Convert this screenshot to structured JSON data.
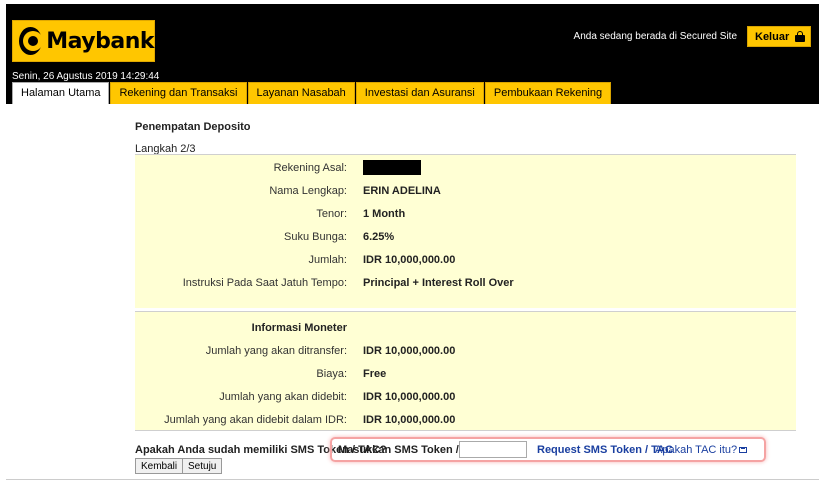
{
  "header": {
    "logo_text": "Maybank",
    "secured_text": "Anda sedang berada di Secured Site",
    "logout_label": "Keluar",
    "datetime": "Senin, 26 Agustus 2019 14:29:44"
  },
  "tabs": [
    {
      "label": "Halaman Utama",
      "active": true
    },
    {
      "label": "Rekening dan Transaksi",
      "active": false
    },
    {
      "label": "Layanan Nasabah",
      "active": false
    },
    {
      "label": "Investasi dan Asuransi",
      "active": false
    },
    {
      "label": "Pembukaan Rekening",
      "active": false
    }
  ],
  "main": {
    "title": "Penempatan Deposito",
    "step": "Langkah 2/3",
    "details": [
      {
        "label": "Rekening Asal:",
        "value": ""
      },
      {
        "label": "Nama Lengkap:",
        "value": "ERIN ADELINA"
      },
      {
        "label": "Tenor:",
        "value": "1 Month"
      },
      {
        "label": "Suku Bunga:",
        "value": "6.25%"
      },
      {
        "label": "Jumlah:",
        "value": "IDR 10,000,000.00"
      },
      {
        "label": "Instruksi Pada Saat Jatuh Tempo:",
        "value": "Principal + Interest Roll Over"
      }
    ],
    "money_info_heading": "Informasi Moneter",
    "money_info": [
      {
        "label": "Jumlah yang akan ditransfer:",
        "value": "IDR 10,000,000.00"
      },
      {
        "label": "Biaya:",
        "value": "Free"
      },
      {
        "label": "Jumlah yang akan didebit:",
        "value": "IDR 10,000,000.00"
      },
      {
        "label": "Jumlah yang akan didebit dalam IDR:",
        "value": "IDR 10,000,000.00"
      }
    ],
    "token_question": "Apakah Anda sudah memiliki SMS Token / TAC?",
    "token_input_label": "Masukkan SMS Token / TAC:",
    "token_input_value": "",
    "request_token_link": "Request SMS Token / TAC",
    "what_is_tac_link": "Apakah TAC itu?",
    "back_button": "Kembali",
    "agree_button": "Setuju"
  },
  "colors": {
    "brand_yellow": "#ffc600",
    "header_bg": "#000000",
    "form_bg": "#ffffd4",
    "link": "#1a3fa0",
    "highlight": "#f5a3a3"
  }
}
